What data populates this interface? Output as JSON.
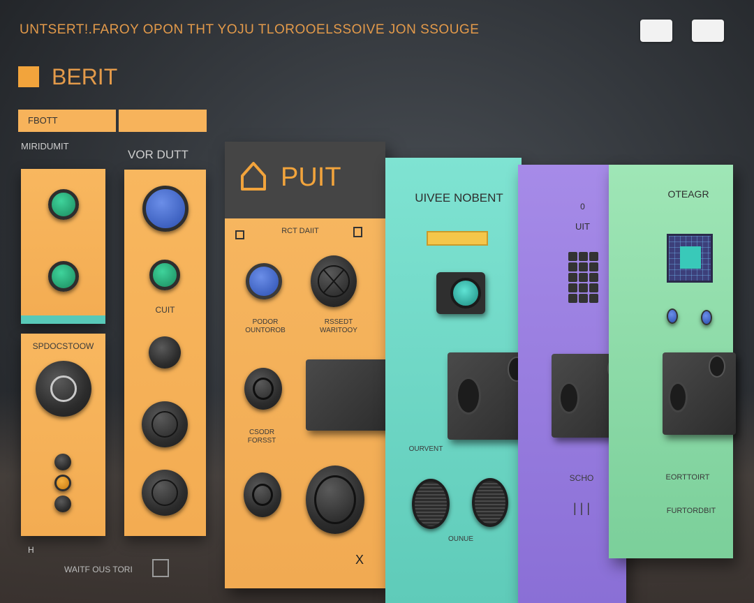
{
  "header": {
    "title": "UNTSERT!.FAROY OPON THT YOJU TLOROOELSSOIVE JON SSOUGE"
  },
  "brand": {
    "label": "BERIT",
    "accent": "#f2a43c"
  },
  "chips": [
    {
      "label": "FBOTT"
    },
    {
      "label": ""
    }
  ],
  "left_panel": {
    "label": "MIRIDUMIT",
    "section_label": "SPDOCSTOOW"
  },
  "mid_panel": {
    "label": "VOR DUTT",
    "button_label": "CUIT"
  },
  "main_panel": {
    "title": "PUIT",
    "subtitle": "RCT DAIIT",
    "btn1_label": "PODOR OUNTOROB",
    "btn2_label": "RSSEDT WARITOOY",
    "btn3_label": "CSODR FORSST",
    "close_label": "X"
  },
  "teal_panel": {
    "title": "UIVEE NOBENT",
    "label": "OURVENT",
    "footer": "OUNUE"
  },
  "purple_panel": {
    "top": "0",
    "title": "UIT",
    "label": "SCHO",
    "marks": "| | |"
  },
  "green_panel": {
    "title": "OTEAGR",
    "label": "EORTTOIRT",
    "footer": "FURTORDBIT"
  },
  "bottom": {
    "left_mark": "H",
    "label": "WAITF OUS TORI"
  },
  "colors": {
    "orange": "#f3ac52",
    "teal": "#5fcbb9",
    "purple": "#8a6fd6",
    "green": "#7bcf9a",
    "header_text": "#e39a4a"
  }
}
